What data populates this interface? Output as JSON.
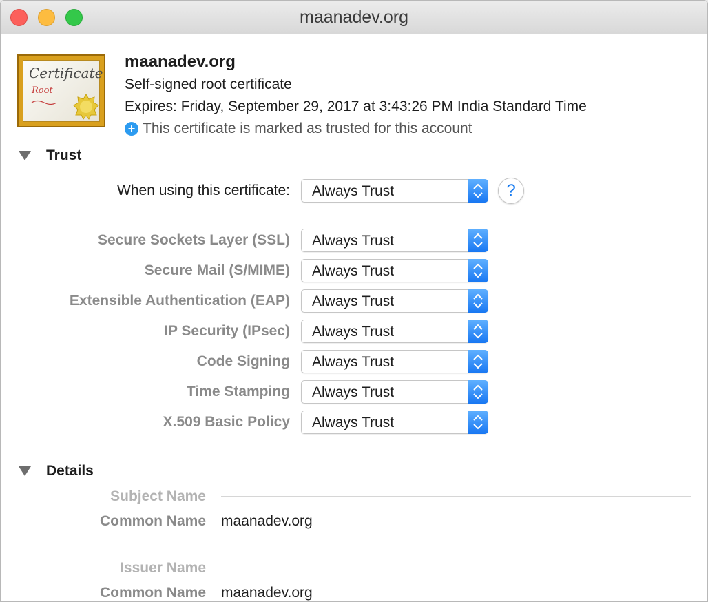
{
  "window": {
    "title": "maanadev.org"
  },
  "certificate": {
    "name": "maanadev.org",
    "kind": "Self-signed root certificate",
    "expires": "Expires: Friday, September 29, 2017 at 3:43:26 PM India Standard Time",
    "trusted_note": "This certificate is marked as trusted for this account",
    "icon": {
      "word": "Certificate",
      "sub": "Root"
    }
  },
  "trust": {
    "title": "Trust",
    "when_using_label": "When using this certificate:",
    "when_using_value": "Always Trust",
    "help_label": "?",
    "policies": [
      {
        "label": "Secure Sockets Layer (SSL)",
        "value": "Always Trust"
      },
      {
        "label": "Secure Mail (S/MIME)",
        "value": "Always Trust"
      },
      {
        "label": "Extensible Authentication (EAP)",
        "value": "Always Trust"
      },
      {
        "label": "IP Security (IPsec)",
        "value": "Always Trust"
      },
      {
        "label": "Code Signing",
        "value": "Always Trust"
      },
      {
        "label": "Time Stamping",
        "value": "Always Trust"
      },
      {
        "label": "X.509 Basic Policy",
        "value": "Always Trust"
      }
    ]
  },
  "details": {
    "title": "Details",
    "subject_heading": "Subject Name",
    "subject_common_name_label": "Common Name",
    "subject_common_name_value": "maanadev.org",
    "issuer_heading": "Issuer Name",
    "issuer_common_name_label": "Common Name",
    "issuer_common_name_value": "maanadev.org"
  },
  "colors": {
    "accent": "#1877f2",
    "close": "#fc605b",
    "minimize": "#fdbc40",
    "maximize": "#34c84a"
  }
}
